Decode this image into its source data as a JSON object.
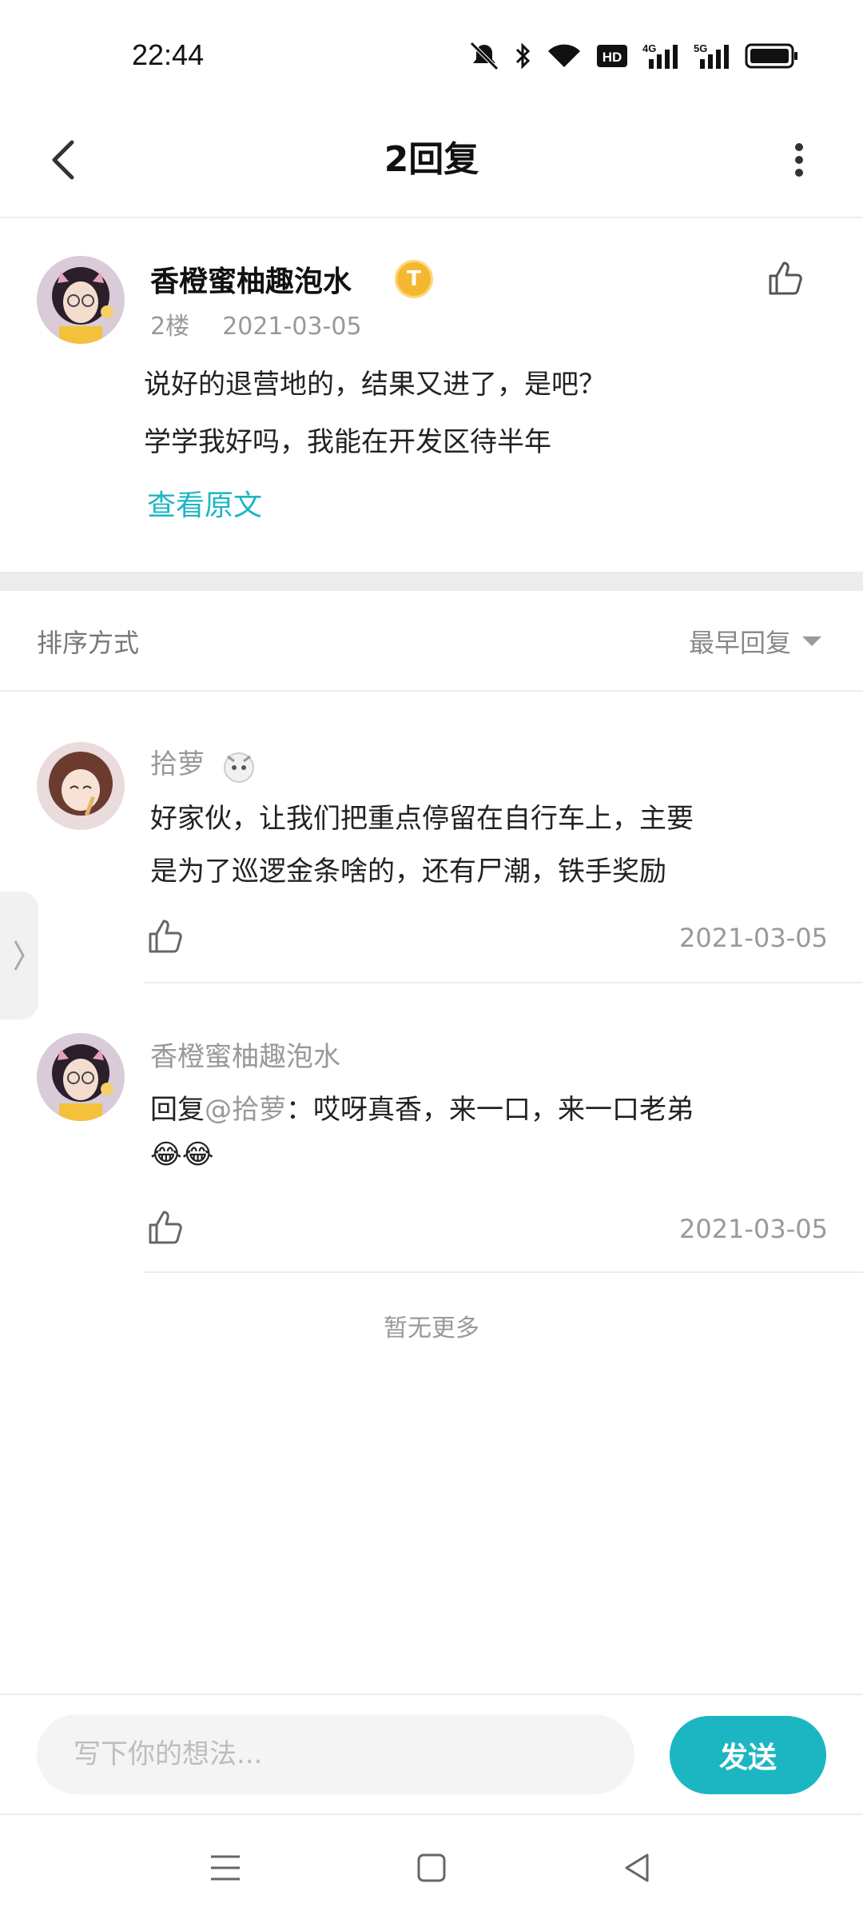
{
  "status_bar": {
    "time": "22:44",
    "icons": [
      "mute-icon",
      "bluetooth-icon",
      "wifi-icon",
      "hd-icon",
      "signal-4g-icon",
      "signal-5g-icon",
      "battery-icon"
    ],
    "hd_label": "HD",
    "net1_label": "4G",
    "net2_label": "5G"
  },
  "header": {
    "title": "2回复"
  },
  "main_post": {
    "author": "香橙蜜柚趣泡水",
    "level_badge": "T",
    "floor": "2楼",
    "date": "2021-03-05",
    "lines": [
      "说好的退营地的，结果又进了，是吧？",
      "学学我好吗，我能在开发区待半年"
    ],
    "view_original": "查看原文"
  },
  "sort": {
    "label": "排序方式",
    "value": "最早回复"
  },
  "replies": [
    {
      "author": "拾萝",
      "lines": [
        "好家伙，让我们把重点停留在自行车上，主要",
        "是为了巡逻金条啥的，还有尸潮，铁手奖励"
      ],
      "date": "2021-03-05"
    },
    {
      "author": "香橙蜜柚趣泡水",
      "reply_prefix": "回复",
      "reply_to": "@拾萝",
      "reply_sep": "：",
      "line1": "哎呀真香，来一口，来一口老弟",
      "line2": "😂😂",
      "date": "2021-03-05"
    }
  ],
  "no_more": "暂无更多",
  "input": {
    "placeholder": "写下你的想法...",
    "send_label": "发送"
  },
  "colors": {
    "accent": "#1cb6c3",
    "badge": "#f5b731"
  }
}
